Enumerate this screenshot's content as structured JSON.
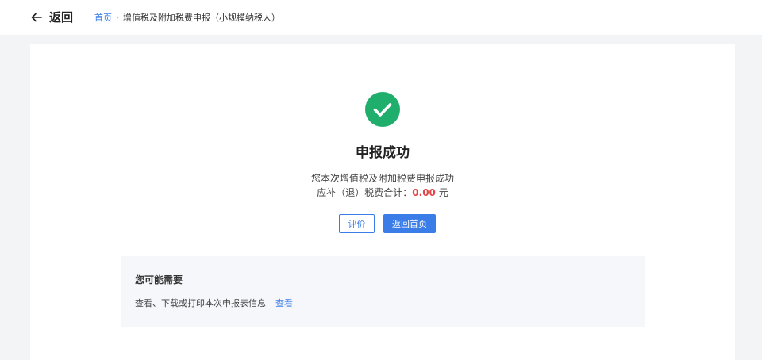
{
  "header": {
    "back_label": "返回",
    "breadcrumb": {
      "home": "首页",
      "separator": "›",
      "current": "增值税及附加税费申报（小规模纳税人）"
    }
  },
  "result": {
    "icon": "check-circle-icon",
    "title": "申报成功",
    "description": "您本次增值税及附加税费申报成功",
    "total_label": "应补（退）税费合计：",
    "total_amount": "0.00",
    "total_unit": " 元",
    "eval_button": "评价",
    "home_button": "返回首页"
  },
  "suggestions": {
    "title": "您可能需要",
    "text": "查看、下载或打印本次申报表信息",
    "link": "查看"
  },
  "colors": {
    "accent": "#3b7de8",
    "success": "#1fae6b",
    "amount": "#e0474a"
  }
}
